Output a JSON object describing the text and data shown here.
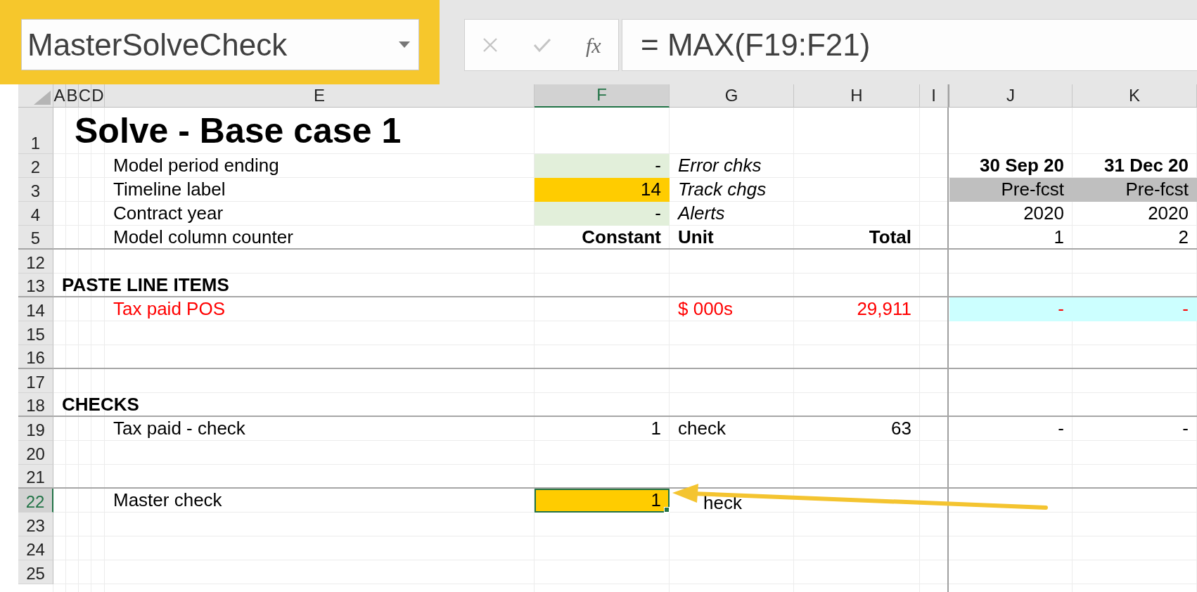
{
  "name_box": {
    "value": "MasterSolveCheck"
  },
  "formula_bar": {
    "function_label": "fx",
    "formula": "= MAX(F19:F21)"
  },
  "columns": [
    {
      "letter": "A",
      "selected": false
    },
    {
      "letter": "B",
      "selected": false
    },
    {
      "letter": "C",
      "selected": false
    },
    {
      "letter": "D",
      "selected": false
    },
    {
      "letter": "E",
      "selected": false
    },
    {
      "letter": "F",
      "selected": true
    },
    {
      "letter": "G",
      "selected": false
    },
    {
      "letter": "H",
      "selected": false
    },
    {
      "letter": "I",
      "selected": false
    },
    {
      "letter": "J",
      "selected": false
    },
    {
      "letter": "K",
      "selected": false
    }
  ],
  "rows": [
    {
      "number": "1",
      "selected": false,
      "kind": "title",
      "cells": {
        "B": {
          "text": "Solve - Base case 1"
        }
      }
    },
    {
      "number": "2",
      "selected": false,
      "kind": "dates",
      "cells": {
        "E": {
          "text": "Model period ending"
        },
        "F": {
          "text": "-",
          "kind": "input"
        },
        "G": {
          "text": "Error chks"
        },
        "J": {
          "text": "30 Sep 20"
        },
        "K": {
          "text": "31 Dec 20"
        }
      }
    },
    {
      "number": "3",
      "selected": false,
      "kind": "settings",
      "cells": {
        "E": {
          "text": "Timeline label"
        },
        "F": {
          "text": "14",
          "kind": "highlight"
        },
        "G": {
          "text": "Track chgs"
        },
        "J": {
          "text": "Pre-fcst",
          "kind": "shade"
        },
        "K": {
          "text": "Pre-fcst",
          "kind": "shade"
        }
      }
    },
    {
      "number": "4",
      "selected": false,
      "kind": "settings",
      "cells": {
        "E": {
          "text": "Contract year"
        },
        "F": {
          "text": "-",
          "kind": "input"
        },
        "G": {
          "text": "Alerts"
        },
        "J": {
          "text": "2020"
        },
        "K": {
          "text": "2020"
        }
      }
    },
    {
      "number": "5",
      "selected": false,
      "kind": "labels",
      "border_below": true,
      "cells": {
        "E": {
          "text": "Model column counter"
        },
        "F": {
          "text": "Constant"
        },
        "G": {
          "text": "Unit"
        },
        "H": {
          "text": "Total"
        },
        "J": {
          "text": "1"
        },
        "K": {
          "text": "2"
        }
      }
    },
    {
      "number": "12",
      "selected": false,
      "kind": "blank",
      "cells": {}
    },
    {
      "number": "13",
      "selected": false,
      "kind": "section",
      "border_below": true,
      "cells": {
        "A": {
          "text": "PASTE LINE ITEMS"
        }
      }
    },
    {
      "number": "14",
      "selected": false,
      "kind": "line_item",
      "cells": {
        "E": {
          "text": "Tax paid POS"
        },
        "G": {
          "text": "$ 000s"
        },
        "H": {
          "text": "29,911"
        },
        "J": {
          "text": "-",
          "kind": "link"
        },
        "K": {
          "text": "-",
          "kind": "link"
        }
      }
    },
    {
      "number": "15",
      "selected": false,
      "kind": "blank",
      "cells": {}
    },
    {
      "number": "16",
      "selected": false,
      "kind": "blank",
      "border_below": true,
      "cells": {}
    },
    {
      "number": "17",
      "selected": false,
      "kind": "blank",
      "cells": {}
    },
    {
      "number": "18",
      "selected": false,
      "kind": "section",
      "border_below": true,
      "cells": {
        "A": {
          "text": "CHECKS"
        }
      }
    },
    {
      "number": "19",
      "selected": false,
      "kind": "plain",
      "cells": {
        "E": {
          "text": "Tax paid - check"
        },
        "F": {
          "text": "1"
        },
        "G": {
          "text": "check"
        },
        "H": {
          "text": "63"
        },
        "J": {
          "text": "-"
        },
        "K": {
          "text": "-"
        }
      }
    },
    {
      "number": "20",
      "selected": false,
      "kind": "blank",
      "cells": {}
    },
    {
      "number": "21",
      "selected": false,
      "kind": "blank",
      "border_below": true,
      "cells": {}
    },
    {
      "number": "22",
      "selected": true,
      "kind": "plain",
      "cells": {
        "E": {
          "text": "Master check"
        },
        "F": {
          "text": "1",
          "kind": "highlight"
        },
        "G": {
          "text": "heck",
          "kind": "covered"
        }
      }
    },
    {
      "number": "23",
      "selected": false,
      "kind": "blank",
      "cells": {}
    },
    {
      "number": "24",
      "selected": false,
      "kind": "blank",
      "cells": {}
    },
    {
      "number": "25",
      "selected": false,
      "kind": "blank",
      "cells": {}
    }
  ]
}
